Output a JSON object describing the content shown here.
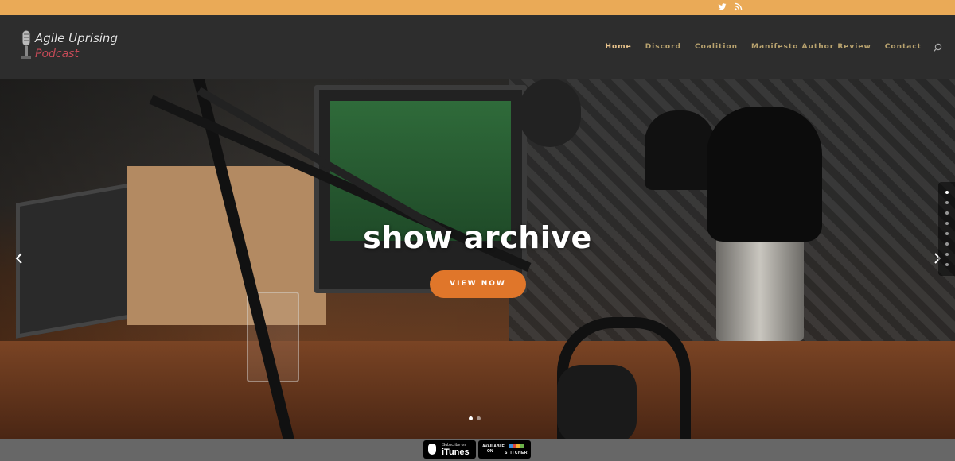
{
  "topbar": {
    "social_icons": [
      "twitter-icon",
      "rss-icon"
    ],
    "background": "#eaaa57"
  },
  "header": {
    "logo": {
      "line1": "Agile Uprising",
      "line2": "Podcast"
    },
    "nav": [
      {
        "label": "Home",
        "active": true
      },
      {
        "label": "Discord",
        "active": false
      },
      {
        "label": "Coalition",
        "active": false
      },
      {
        "label": "Manifesto Author Review",
        "active": false
      },
      {
        "label": "Contact",
        "active": false
      }
    ],
    "search_icon": "search-icon"
  },
  "hero": {
    "title": "show archive",
    "button_label": "VIEW NOW",
    "button_color": "#e0762a",
    "slide_count": 2,
    "active_slide": 1
  },
  "side_nav": {
    "dot_count": 8,
    "active_dot": 1
  },
  "footer": {
    "itunes": {
      "line1": "Subscribe on",
      "line2": "iTunes"
    },
    "stitcher": {
      "line1": "AVAILABLE",
      "line2": "ON",
      "line3": "STITCHER"
    }
  }
}
